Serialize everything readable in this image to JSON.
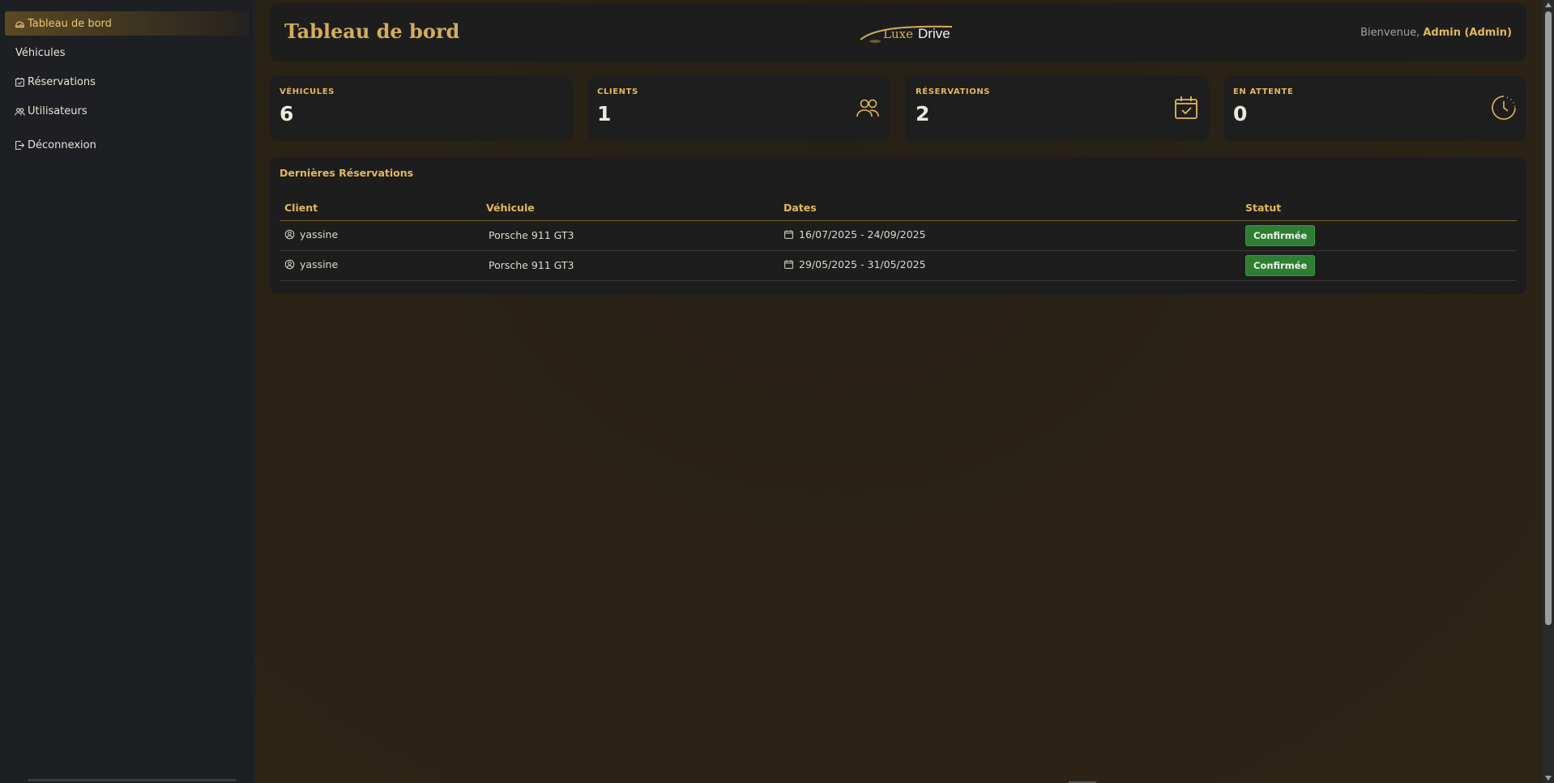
{
  "sidebar": {
    "items": [
      {
        "label": "Tableau de bord",
        "icon": "dashboard-icon",
        "active": true
      },
      {
        "label": "Véhicules",
        "icon": null,
        "active": false
      },
      {
        "label": "Réservations",
        "icon": "calendar-check-icon",
        "active": false
      },
      {
        "label": "Utilisateurs",
        "icon": "users-icon",
        "active": false
      }
    ],
    "logout_label": "Déconnexion"
  },
  "header": {
    "title": "Tableau de bord",
    "logo": {
      "luxe": "Luxe",
      "drive": "Drive"
    },
    "welcome_prefix": "Bienvenue,",
    "user": "Admin (Admin)"
  },
  "stats": [
    {
      "label": "VÉHICULES",
      "value": "6",
      "icon": null
    },
    {
      "label": "CLIENTS",
      "value": "1",
      "icon": "users-icon"
    },
    {
      "label": "RÉSERVATIONS",
      "value": "2",
      "icon": "calendar-check-icon"
    },
    {
      "label": "EN ATTENTE",
      "value": "0",
      "icon": "clock-icon"
    }
  ],
  "reservations": {
    "title": "Dernières Réservations",
    "columns": [
      "Client",
      "Véhicule",
      "Dates",
      "Statut"
    ],
    "rows": [
      {
        "client": "yassine",
        "vehicle": "Porsche 911 GT3",
        "dates": "16/07/2025 - 24/09/2025",
        "status": "Confirmée"
      },
      {
        "client": "yassine",
        "vehicle": "Porsche 911 GT3",
        "dates": "29/05/2025 - 31/05/2025",
        "status": "Confirmée"
      }
    ]
  },
  "colors": {
    "accent": "#e3b75e",
    "title_gold": "#d4ad5b",
    "status_green": "#2e7d32",
    "sidebar_bg": "#1d1f23"
  }
}
